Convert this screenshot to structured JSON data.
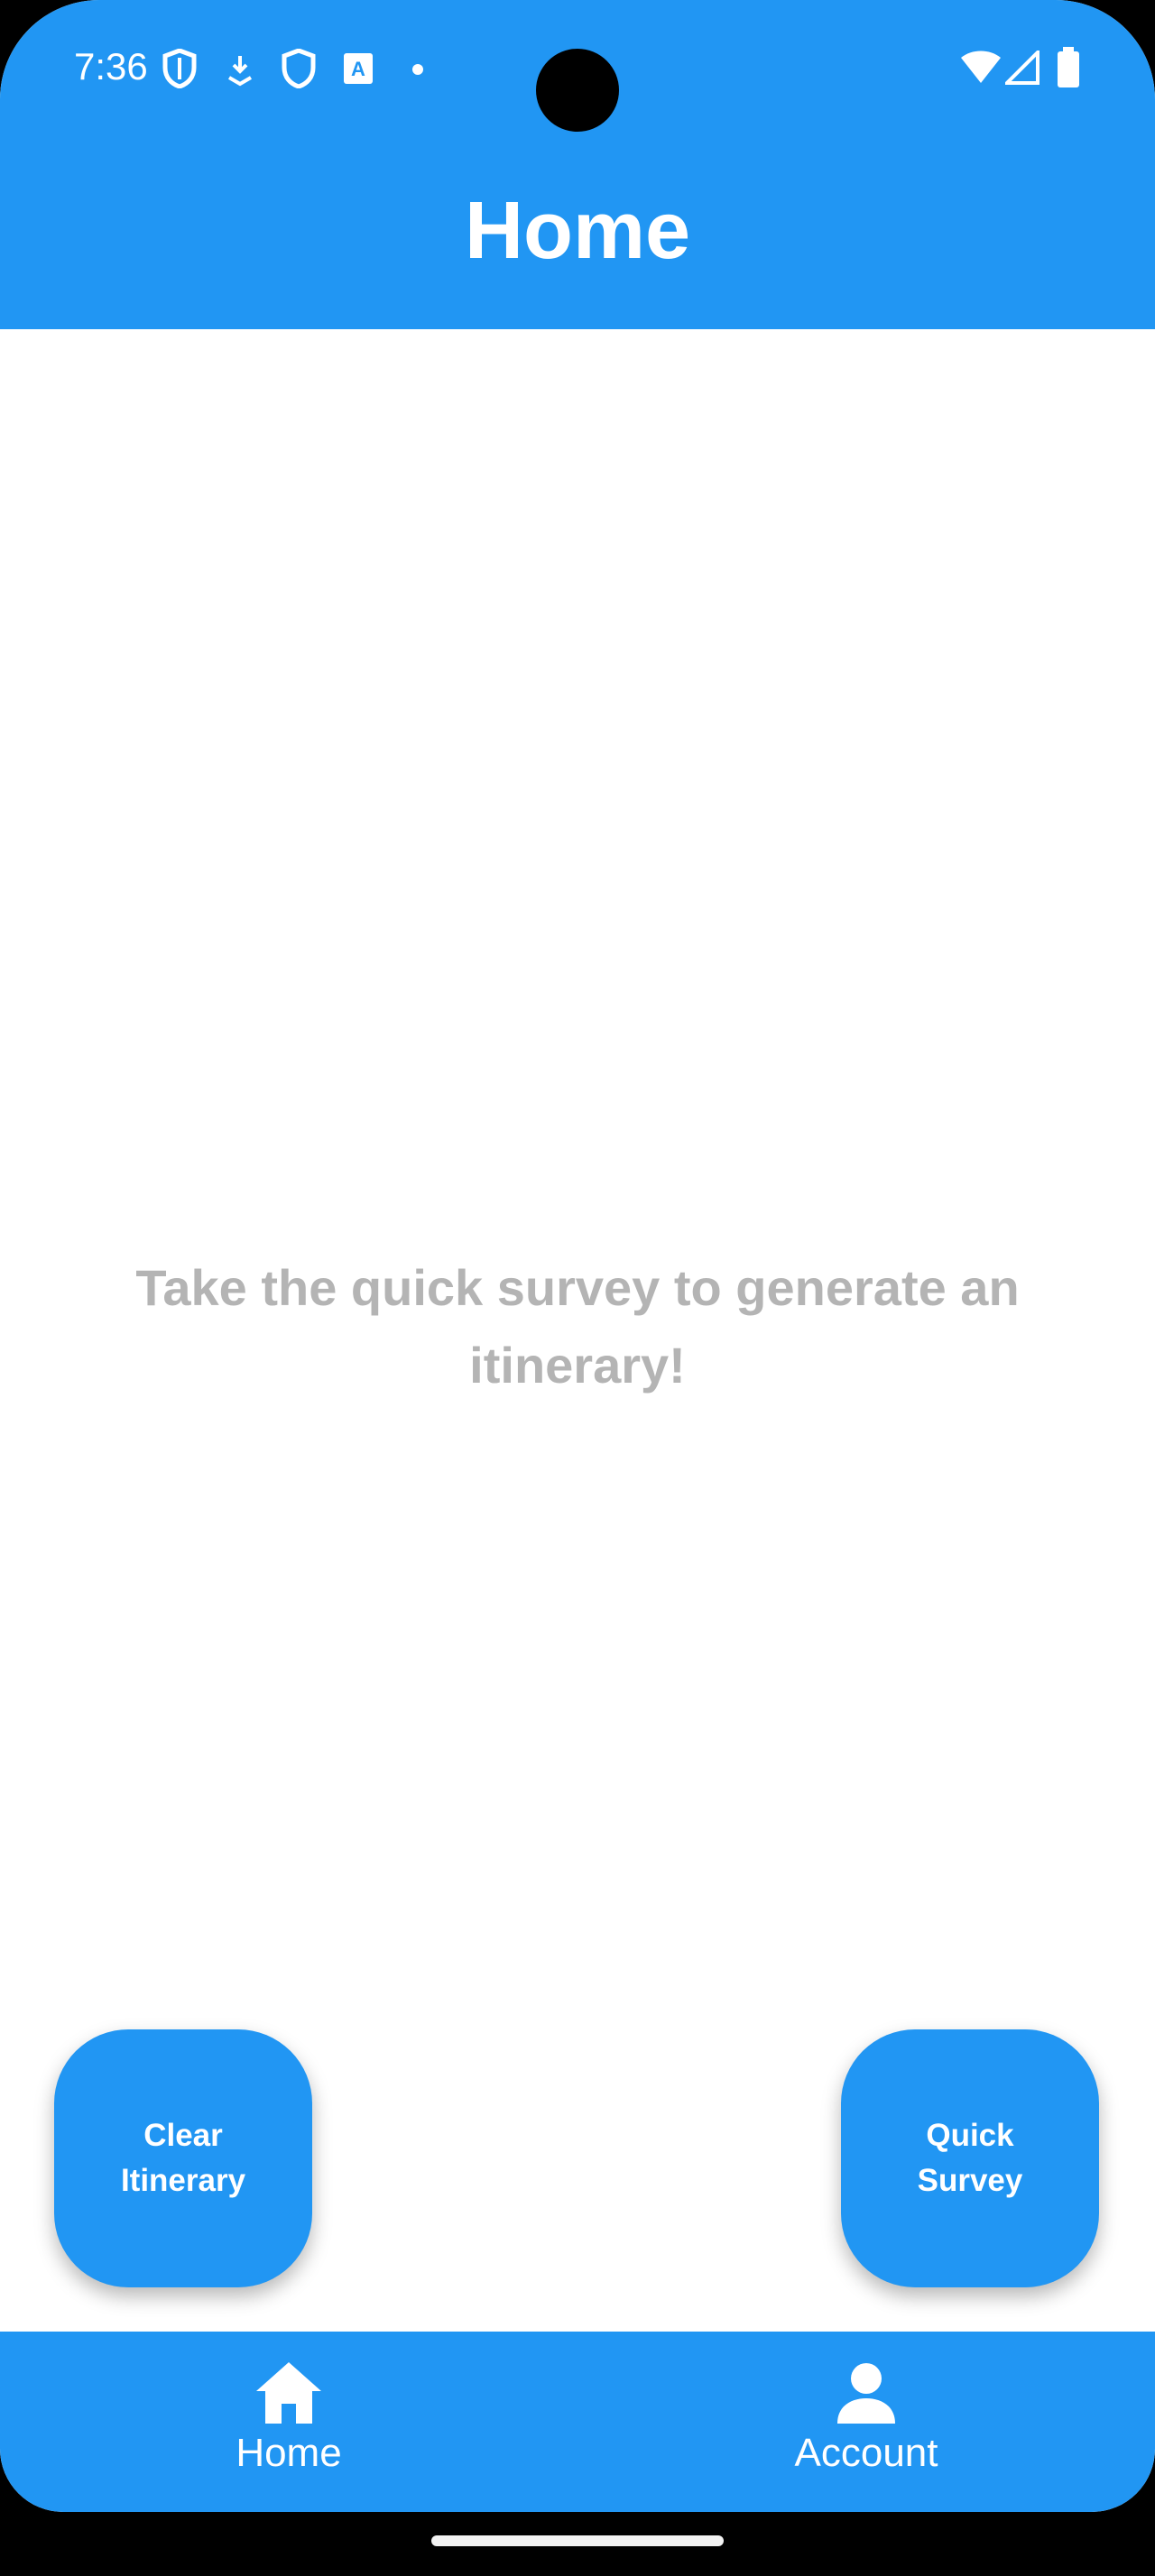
{
  "status_bar": {
    "time": "7:36",
    "left_icons": [
      "shield-icon",
      "download-icon",
      "shield-icon",
      "translate-icon",
      "dot-icon"
    ],
    "right_icons": [
      "wifi-icon",
      "signal-icon",
      "battery-icon"
    ]
  },
  "header": {
    "title": "Home"
  },
  "main": {
    "empty_message": "Take the quick survey to generate an itinerary!"
  },
  "actions": {
    "clear_label": "Clear\nItinerary",
    "survey_label": "Quick\nSurvey"
  },
  "bottom_nav": {
    "items": [
      {
        "label": "Home",
        "icon": "home-icon"
      },
      {
        "label": "Account",
        "icon": "person-icon"
      }
    ]
  },
  "colors": {
    "primary": "#2196F3",
    "placeholder_text": "#B4B4B4",
    "on_primary": "#FFFFFF"
  }
}
